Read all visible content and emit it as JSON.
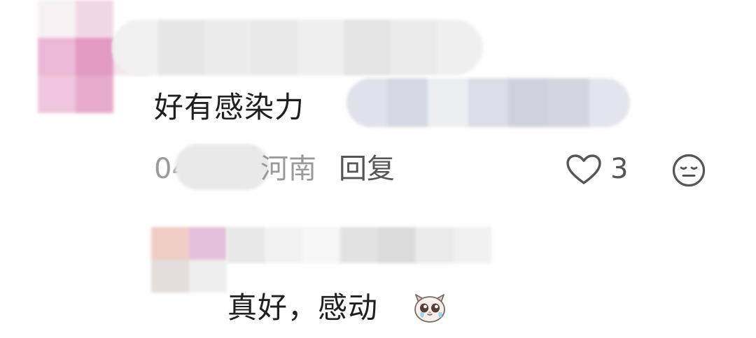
{
  "comment": {
    "text": "好有感染力",
    "meta_prefix": "04",
    "location": "河南",
    "reply_label": "回复",
    "like_count": "3"
  },
  "reply": {
    "text": "真好，感动",
    "emoji": "crying-cat-emoji"
  },
  "icons": {
    "like": "heart-outline-icon",
    "dislike": "neutral-face-icon"
  },
  "colors": {
    "background": "#ffffff",
    "text_primary": "#1f1f1f",
    "text_secondary": "#9a9a9a",
    "action_text": "#555555",
    "avatar_pink": "#e7a9cc"
  }
}
